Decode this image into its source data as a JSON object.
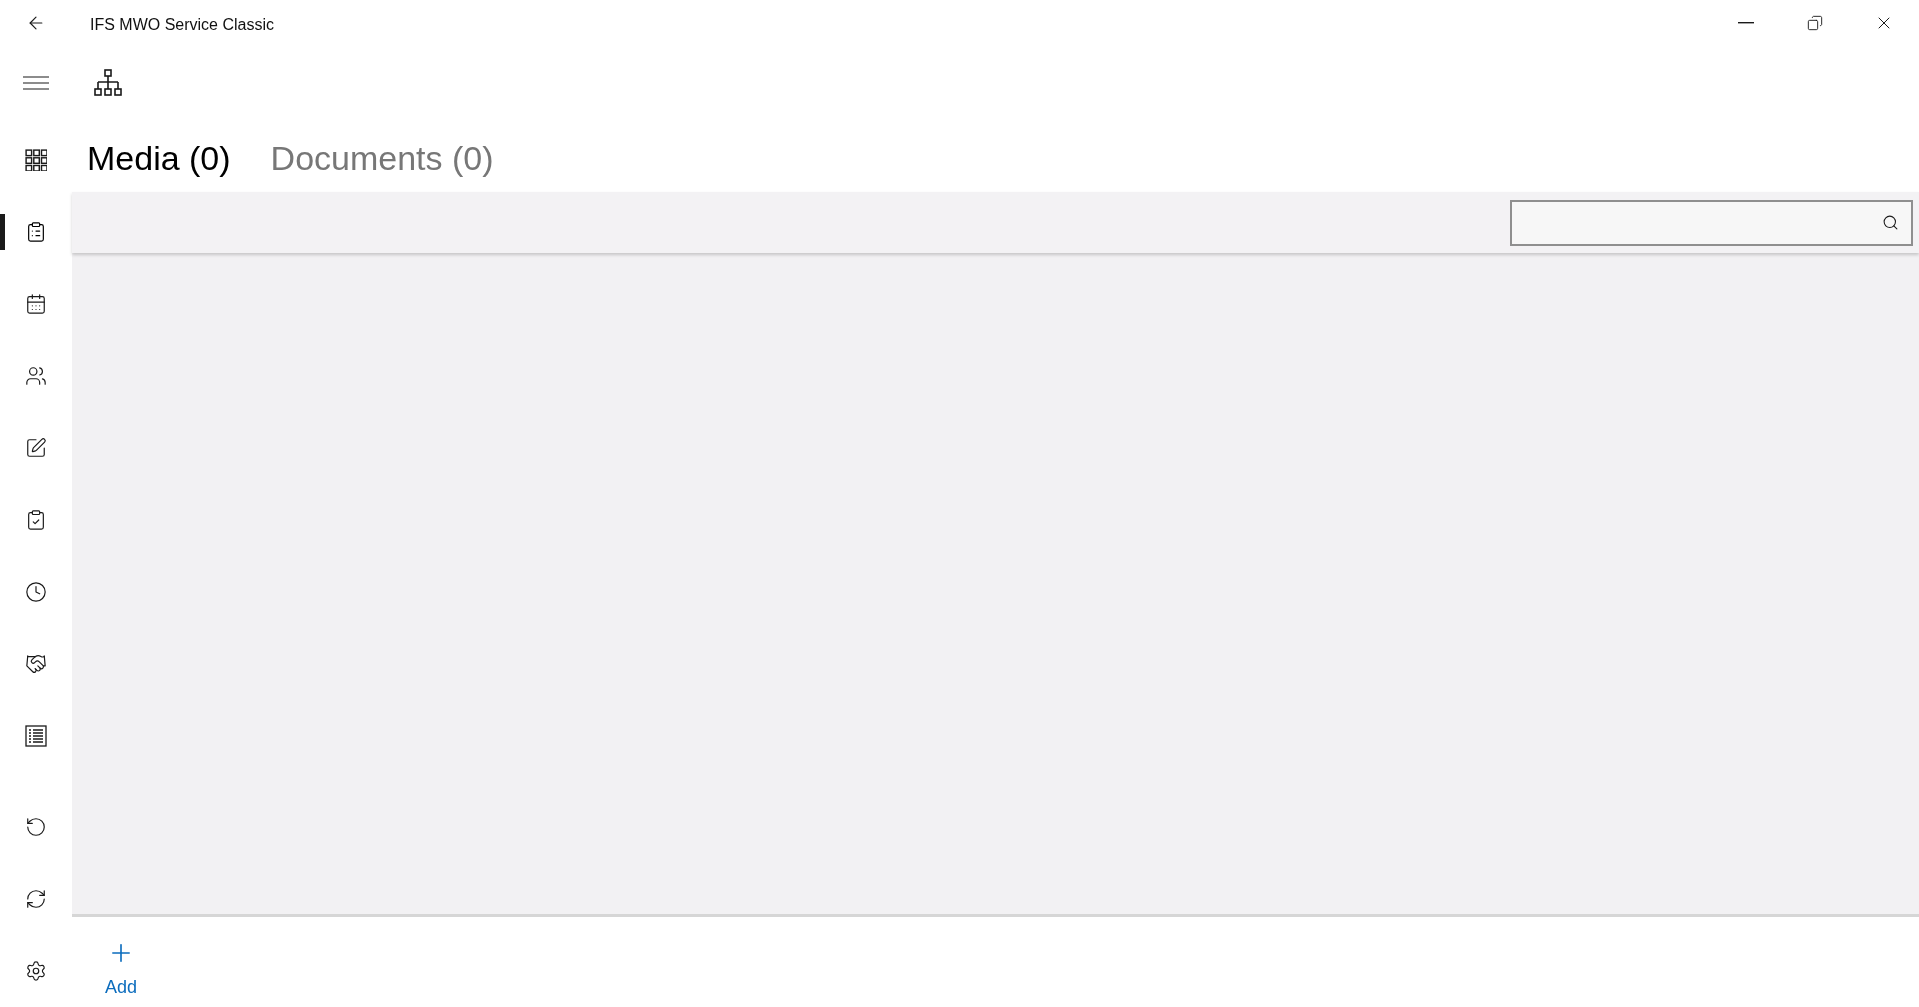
{
  "window": {
    "title": "IFS MWO Service Classic"
  },
  "sidebar": {
    "items": [
      {
        "selected": false
      },
      {
        "selected": true
      },
      {
        "selected": false
      },
      {
        "selected": false
      },
      {
        "selected": false
      },
      {
        "selected": false
      },
      {
        "selected": false
      },
      {
        "selected": false
      },
      {
        "selected": false
      }
    ],
    "footer_items": [
      {
        "selected": false
      },
      {
        "selected": false
      },
      {
        "selected": false
      }
    ]
  },
  "tabs": [
    {
      "label": "Media (0)",
      "selected": true
    },
    {
      "label": "Documents (0)",
      "selected": false
    }
  ],
  "command_bar": {
    "buttons": [
      {
        "label": "Add"
      }
    ]
  }
}
